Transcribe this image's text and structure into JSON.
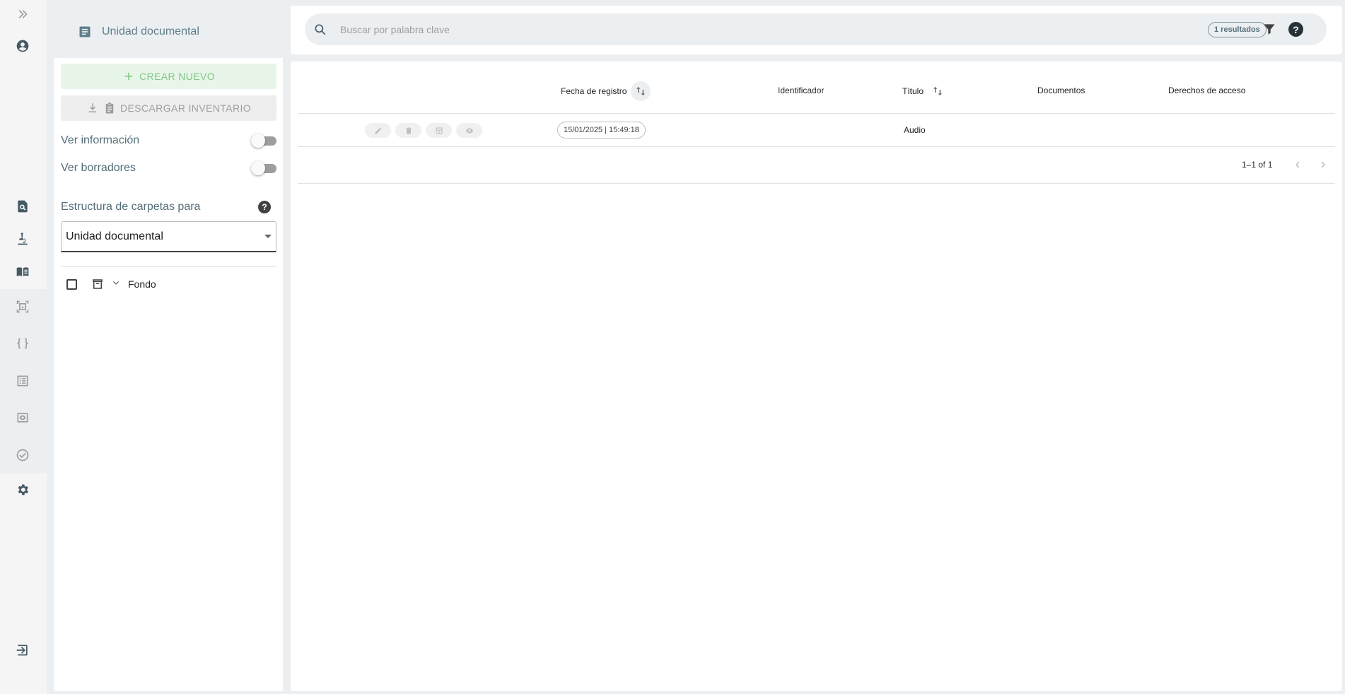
{
  "sidebar": {
    "title": "Unidad documental",
    "create_label": "CREAR NUEVO",
    "download_label": "DESCARGAR INVENTARIO",
    "toggle_info_label": "Ver información",
    "toggle_drafts_label": "Ver borradores",
    "structure_label": "Estructura de carpetas para",
    "structure_select_value": "Unidad documental",
    "tree_root_label": "Fondo"
  },
  "search": {
    "placeholder": "Buscar por palabra clave",
    "results_badge": "1 resultados"
  },
  "table": {
    "columns": {
      "fecha": "Fecha de registro",
      "identificador": "Identificador",
      "titulo": "Título",
      "documentos": "Documentos",
      "derechos": "Derechos de acceso"
    },
    "rows": [
      {
        "fecha": "15/01/2025 | 15:49:18",
        "identificador": "",
        "titulo": "Audio",
        "documentos": "",
        "derechos": ""
      }
    ],
    "pagination": "1–1 of 1"
  },
  "icons": {
    "rail": [
      "double-chevron-right-icon",
      "account-circle-icon",
      "search-document-icon",
      "microscope-icon",
      "book-icon",
      "text-frame-icon",
      "code-braces-icon",
      "list-icon",
      "archive-view-icon",
      "check-circle-icon",
      "gear-icon",
      "logout-icon"
    ]
  },
  "colors": {
    "accent_green": "#81c784",
    "rail_icon": "#455a64",
    "background": "#eceff1"
  }
}
